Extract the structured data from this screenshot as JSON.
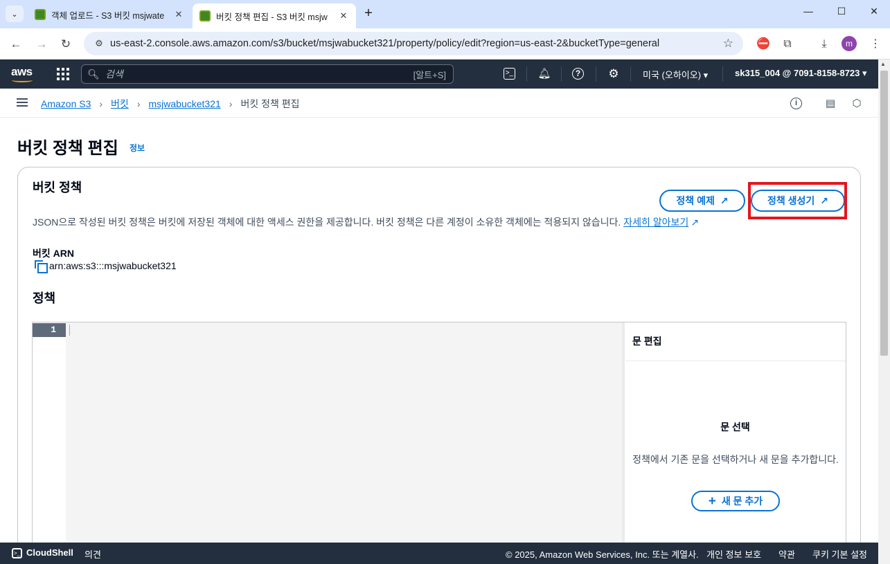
{
  "browser": {
    "tabs": [
      {
        "title": "객체 업로드 - S3 버킷 msjwate",
        "active": false
      },
      {
        "title": "버킷 정책 편집 - S3 버킷 msjw",
        "active": true
      }
    ],
    "url": "us-east-2.console.aws.amazon.com/s3/bucket/msjwabucket321/property/policy/edit?region=us-east-2&bucketType=general",
    "profile_initial": "m"
  },
  "aws_nav": {
    "logo": "aws",
    "search_placeholder": "검색",
    "search_shortcut": "[알트+S]",
    "region": "미국 (오하이오) ▾",
    "account": "sk315_004 @ 7091-8158-8723 ▾"
  },
  "breadcrumb": {
    "items": [
      "Amazon S3",
      "버킷",
      "msjwabucket321"
    ],
    "current": "버킷 정책 편집"
  },
  "page": {
    "title": "버킷 정책 편집",
    "info": "정보"
  },
  "section": {
    "title": "버킷 정책",
    "examples_button": "정책 예제",
    "generator_button": "정책 생성기",
    "description": "JSON으로 작성된 버킷 정책은 버킷에 저장된 객체에 대한 액세스 권한을 제공합니다. 버킷 정책은 다른 계정이 소유한 객체에는 적용되지 않습니다.",
    "learn_more": "자세히 알아보기",
    "arn_label": "버킷 ARN",
    "arn_value": "arn:aws:s3:::msjwabucket321",
    "policy_label": "정책"
  },
  "editor": {
    "line_number": "1",
    "side_header": "문 편집",
    "side_title": "문 선택",
    "side_text": "정책에서 기존 문을 선택하거나 새 문을 추가합니다.",
    "add_button": "새 문 추가"
  },
  "footer": {
    "cloudshell": "CloudShell",
    "feedback": "의견",
    "copyright": "© 2025, Amazon Web Services, Inc. 또는 계열사.",
    "privacy": "개인 정보 보호",
    "terms": "약관",
    "cookies": "쿠키 기본 설정"
  },
  "colors": {
    "accent": "#0972d3",
    "nav_bg": "#232f3e",
    "highlight": "#e3161e"
  }
}
